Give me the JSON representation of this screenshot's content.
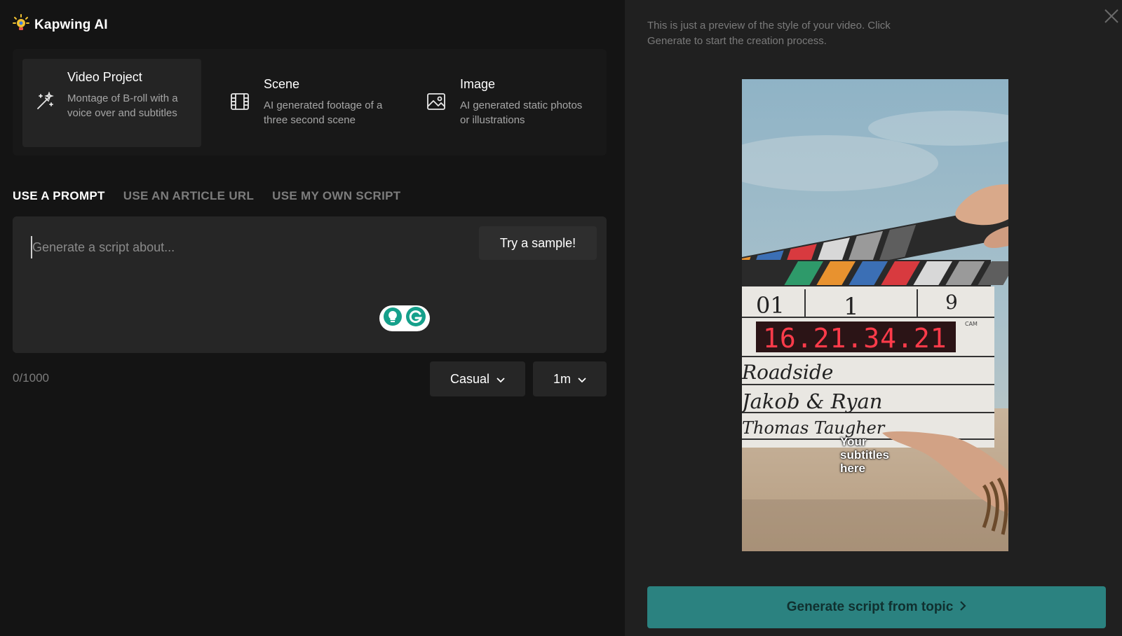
{
  "brand": {
    "name": "Kapwing AI"
  },
  "modes": [
    {
      "title": "Video Project",
      "description": "Montage of B-roll with a voice over and subtitles",
      "icon": "magic-wand-icon",
      "active": true
    },
    {
      "title": "Scene",
      "description": "AI generated footage of a three second scene",
      "icon": "film-strip-icon",
      "active": false
    },
    {
      "title": "Image",
      "description": "AI generated static photos or illustrations",
      "icon": "image-icon",
      "active": false
    }
  ],
  "tabs": [
    {
      "label": "USE A PROMPT",
      "active": true
    },
    {
      "label": "USE AN ARTICLE URL",
      "active": false
    },
    {
      "label": "USE MY OWN SCRIPT",
      "active": false
    }
  ],
  "prompt": {
    "placeholder": "Generate a script about...",
    "value": "",
    "sample_button": "Try a sample!",
    "counter": "0/1000"
  },
  "options": {
    "tone": "Casual",
    "length": "1m"
  },
  "preview": {
    "note": "This is just a preview of the style of your video. Click Generate to start the creation process.",
    "subtitle": "Your subtitles here",
    "clapper": {
      "scene": "01",
      "take": "1",
      "roll": "9",
      "timecode": "16.21.34.21",
      "production": "Roadside",
      "director": "Jakob & Ryan",
      "camera": "Thomas Taugher",
      "cam_label": "CAM"
    }
  },
  "generate_button": {
    "label": "Generate script from topic"
  },
  "colors": {
    "accent": "#2b8280",
    "left_bg": "#141414",
    "right_bg": "#202020",
    "timecode": "#ff3b4a"
  }
}
